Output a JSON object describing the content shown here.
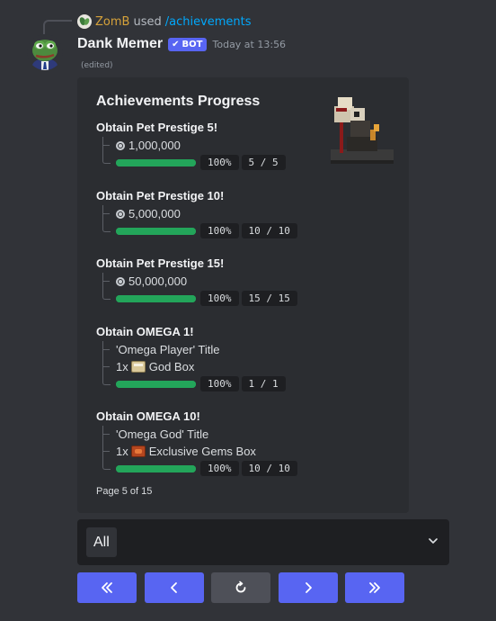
{
  "reply": {
    "username": "ZomB",
    "text": "used",
    "command": "/achievements"
  },
  "message": {
    "username": "Dank Memer",
    "bot_badge": "BOT",
    "timestamp": "Today at 13:56",
    "edited": "(edited)"
  },
  "embed": {
    "title": "Achievements Progress",
    "achievements": [
      {
        "title": "Obtain Pet Prestige 5!",
        "rewards": [
          {
            "icon": "coin-icon",
            "text": "1,000,000"
          }
        ],
        "progress": 1.0,
        "percent": "100%",
        "count": "5 / 5"
      },
      {
        "title": "Obtain Pet Prestige 10!",
        "rewards": [
          {
            "icon": "coin-icon",
            "text": "5,000,000"
          }
        ],
        "progress": 1.0,
        "percent": "100%",
        "count": "10 / 10"
      },
      {
        "title": "Obtain Pet Prestige 15!",
        "rewards": [
          {
            "icon": "coin-icon",
            "text": "50,000,000"
          }
        ],
        "progress": 1.0,
        "percent": "100%",
        "count": "15 / 15"
      },
      {
        "title": "Obtain OMEGA 1!",
        "rewards": [
          {
            "icon": "",
            "text": "'Omega Player' Title"
          },
          {
            "icon": "god-box-icon",
            "prefix": "1x",
            "text": "God Box"
          }
        ],
        "progress": 1.0,
        "percent": "100%",
        "count": "1 / 1"
      },
      {
        "title": "Obtain OMEGA 10!",
        "rewards": [
          {
            "icon": "",
            "text": "'Omega God' Title"
          },
          {
            "icon": "gems-box-icon",
            "prefix": "1x",
            "text": "Exclusive Gems Box"
          }
        ],
        "progress": 1.0,
        "percent": "100%",
        "count": "10 / 10"
      }
    ],
    "footer": "Page 5 of 15"
  },
  "select": {
    "value": "All"
  },
  "buttons": [
    {
      "name": "first-page-button",
      "icon": "double-chevron-left-icon"
    },
    {
      "name": "previous-page-button",
      "icon": "chevron-left-icon"
    },
    {
      "name": "refresh-button",
      "icon": "refresh-icon"
    },
    {
      "name": "next-page-button",
      "icon": "chevron-right-icon"
    },
    {
      "name": "last-page-button",
      "icon": "double-chevron-right-icon"
    }
  ],
  "colors": {
    "background": "#313338",
    "embed": "#2b2d31",
    "blurple": "#5865f2",
    "progress": "#23a55a",
    "reply_user": "#d6a23a",
    "link": "#00a8fc"
  }
}
